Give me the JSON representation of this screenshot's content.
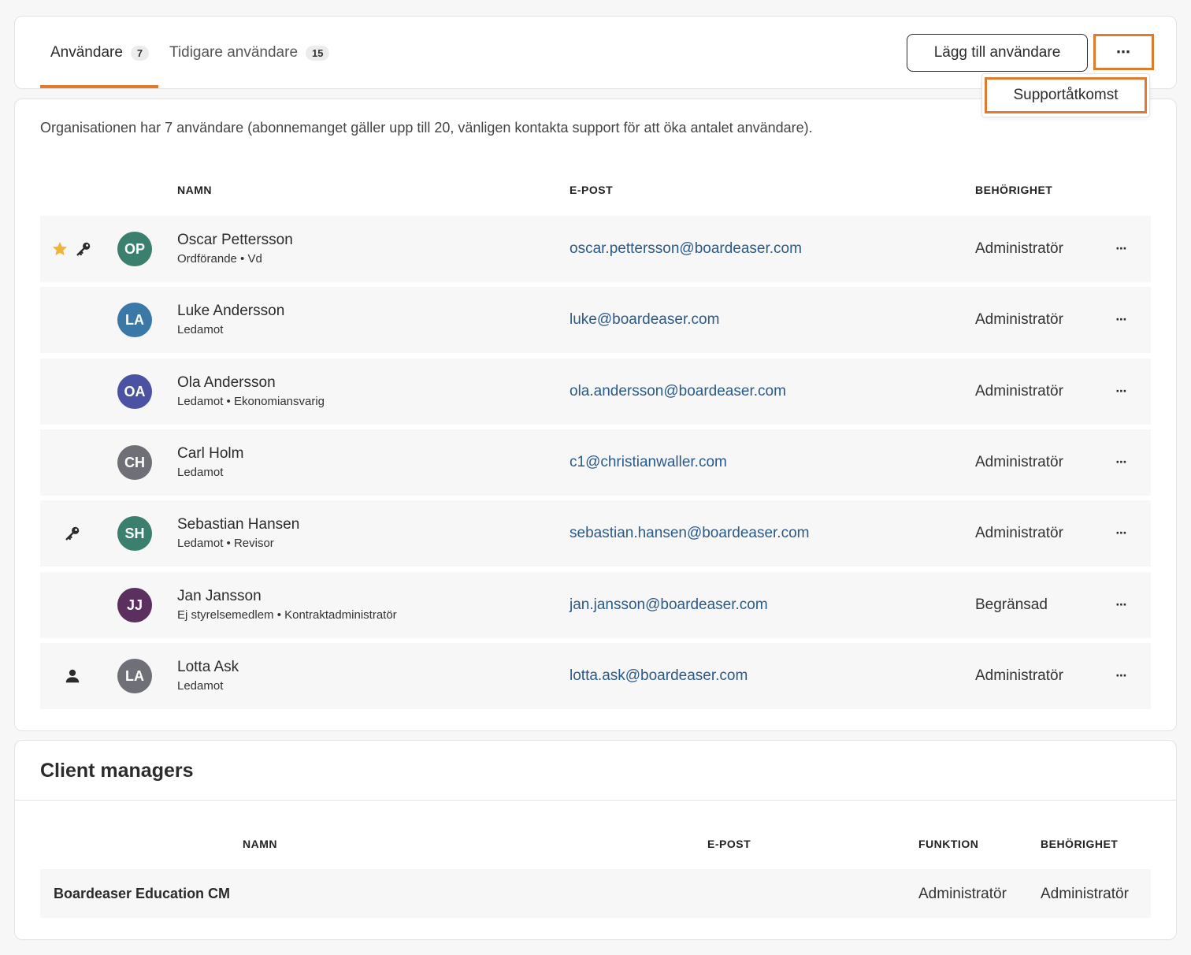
{
  "tabs": [
    {
      "label": "Användare",
      "count": "7"
    },
    {
      "label": "Tidigare användare",
      "count": "15"
    }
  ],
  "header_actions": {
    "add_user_label": "Lägg till användare",
    "more_label": "⋯"
  },
  "dropdown": {
    "support_access_label": "Supportåtkomst"
  },
  "accent_color": "#e07a2f",
  "link_color": "#2a5a8a",
  "users_section": {
    "info_text": "Organisationen har 7 användare (abonnemanget gäller upp till 20, vänligen kontakta support för att öka antalet användare).",
    "columns": {
      "name": "NAMN",
      "email": "E-POST",
      "permission": "BEHÖRIGHET"
    },
    "rows": [
      {
        "initials": "OP",
        "avatar_color": "#3b7f6e",
        "icons": [
          "star-icon",
          "key-icon"
        ],
        "name": "Oscar Pettersson",
        "subtitle": "Ordförande • Vd",
        "email": "oscar.pettersson@boardeaser.com",
        "permission": "Administratör",
        "more": "⋯"
      },
      {
        "initials": "LA",
        "avatar_color": "#3a78a8",
        "icons": [],
        "name": "Luke Andersson",
        "subtitle": "Ledamot",
        "email": "luke@boardeaser.com",
        "permission": "Administratör",
        "more": "⋯"
      },
      {
        "initials": "OA",
        "avatar_color": "#4b52a3",
        "icons": [],
        "name": "Ola Andersson",
        "subtitle": "Ledamot • Ekonomiansvarig",
        "email": "ola.andersson@boardeaser.com",
        "permission": "Administratör",
        "more": "⋯"
      },
      {
        "initials": "CH",
        "avatar_color": "#6f6f78",
        "icons": [],
        "name": "Carl Holm",
        "subtitle": "Ledamot",
        "email": "c1@christianwaller.com",
        "permission": "Administratör",
        "more": "⋯"
      },
      {
        "initials": "SH",
        "avatar_color": "#3b7f6e",
        "icons": [
          "key-icon"
        ],
        "name": "Sebastian Hansen",
        "subtitle": "Ledamot • Revisor",
        "email": "sebastian.hansen@boardeaser.com",
        "permission": "Administratör",
        "more": "⋯"
      },
      {
        "initials": "JJ",
        "avatar_color": "#5b2f5e",
        "icons": [],
        "name": "Jan Jansson",
        "subtitle": "Ej styrelsemedlem • Kontraktadministratör",
        "email": "jan.jansson@boardeaser.com",
        "permission": "Begränsad",
        "more": "⋯"
      },
      {
        "initials": "LA",
        "avatar_color": "#6f6f78",
        "icons": [
          "person-icon"
        ],
        "name": "Lotta Ask",
        "subtitle": "Ledamot",
        "email": "lotta.ask@boardeaser.com",
        "permission": "Administratör",
        "more": "⋯"
      }
    ]
  },
  "client_managers": {
    "title": "Client managers",
    "columns": {
      "name": "NAMN",
      "email": "E-POST",
      "function": "FUNKTION",
      "permission": "BEHÖRIGHET"
    },
    "rows": [
      {
        "name": "Boardeaser Education CM",
        "email": "",
        "function": "Administratör",
        "permission": "Administratör"
      }
    ]
  }
}
